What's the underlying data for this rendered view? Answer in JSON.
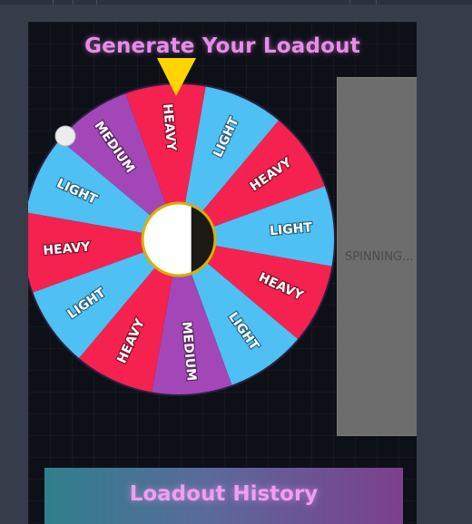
{
  "header": {
    "title": "Generate Your Loadout"
  },
  "wheel": {
    "segments": [
      {
        "label": "LIGHT",
        "color": "#4ec0f4"
      },
      {
        "label": "MEDIUM",
        "color": "#a347b8"
      },
      {
        "label": "HEAVY",
        "color": "#f5214f"
      },
      {
        "label": "LIGHT",
        "color": "#4ec0f4"
      },
      {
        "label": "HEAVY",
        "color": "#f5214f"
      },
      {
        "label": "LIGHT",
        "color": "#4ec0f4"
      },
      {
        "label": "HEAVY",
        "color": "#f5214f"
      },
      {
        "label": "LIGHT",
        "color": "#4ec0f4"
      },
      {
        "label": "MEDIUM",
        "color": "#a347b8"
      },
      {
        "label": "HEAVY",
        "color": "#f5214f"
      },
      {
        "label": "LIGHT",
        "color": "#4ec0f4"
      },
      {
        "label": "HEAVY",
        "color": "#f5214f"
      }
    ],
    "pointer_color": "#ffd400",
    "hub_border_color": "#d8b000"
  },
  "status_panel": {
    "text": "SPINNING..."
  },
  "history": {
    "title": "Loadout History"
  }
}
